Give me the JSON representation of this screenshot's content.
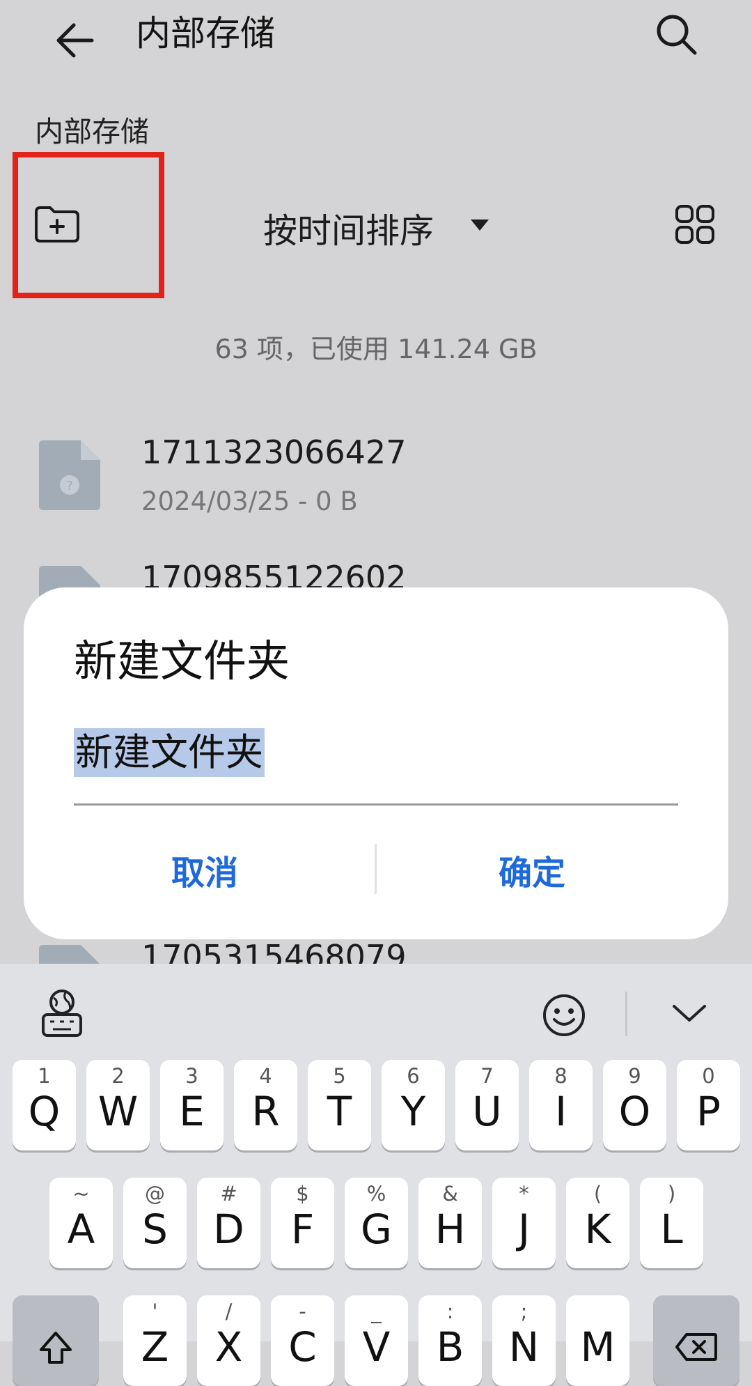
{
  "header": {
    "title": "内部存储"
  },
  "breadcrumb": "内部存储",
  "toolbar": {
    "sort_label": "按时间排序"
  },
  "summary": "63 项，已使用 141.24 GB",
  "files": [
    {
      "name": "1711323066427",
      "meta": "2024/03/25 - 0 B"
    },
    {
      "name": "1709855122602",
      "meta": ""
    },
    {
      "name": "1705315468079",
      "meta": ""
    }
  ],
  "dialog": {
    "title": "新建文件夹",
    "input_value": "新建文件夹",
    "cancel_label": "取消",
    "ok_label": "确定"
  },
  "keyboard": {
    "row1": [
      {
        "hint": "1",
        "key": "Q"
      },
      {
        "hint": "2",
        "key": "W"
      },
      {
        "hint": "3",
        "key": "E"
      },
      {
        "hint": "4",
        "key": "R"
      },
      {
        "hint": "5",
        "key": "T"
      },
      {
        "hint": "6",
        "key": "Y"
      },
      {
        "hint": "7",
        "key": "U"
      },
      {
        "hint": "8",
        "key": "I"
      },
      {
        "hint": "9",
        "key": "O"
      },
      {
        "hint": "0",
        "key": "P"
      }
    ],
    "row2": [
      {
        "hint": "~",
        "key": "A"
      },
      {
        "hint": "@",
        "key": "S"
      },
      {
        "hint": "#",
        "key": "D"
      },
      {
        "hint": "$",
        "key": "F"
      },
      {
        "hint": "%",
        "key": "G"
      },
      {
        "hint": "&",
        "key": "H"
      },
      {
        "hint": "*",
        "key": "J"
      },
      {
        "hint": "(",
        "key": "K"
      },
      {
        "hint": ")",
        "key": "L"
      }
    ],
    "row3": [
      {
        "hint": "'",
        "key": "Z"
      },
      {
        "hint": "/",
        "key": "X"
      },
      {
        "hint": "-",
        "key": "C"
      },
      {
        "hint": "_",
        "key": "V"
      },
      {
        "hint": ":",
        "key": "B"
      },
      {
        "hint": ";",
        "key": "N"
      },
      {
        "hint": "",
        "key": "M"
      }
    ]
  },
  "colors": {
    "accent": "#1f6ad8",
    "highlight_box": "#e2231a",
    "selection": "#b6c9e8"
  }
}
